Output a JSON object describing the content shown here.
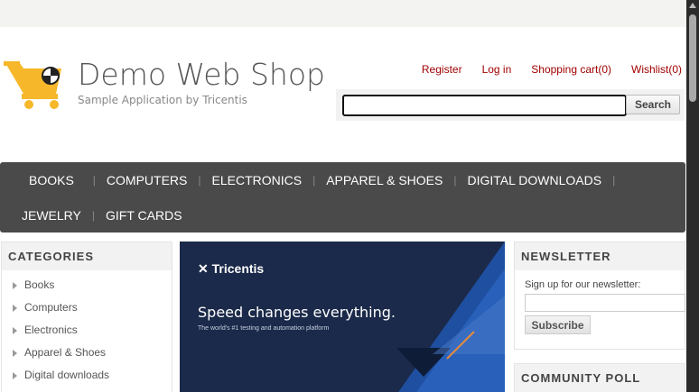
{
  "site": {
    "title": "Demo Web Shop",
    "subtitle": "Sample Application by Tricentis",
    "logo_icon": "shopping-cart-icon"
  },
  "header_links": [
    "Register",
    "Log in",
    "Shopping cart(0)",
    "Wishlist(0)"
  ],
  "search": {
    "value": "",
    "button_label": "Search"
  },
  "topmenu": {
    "row1": [
      "BOOKS",
      "COMPUTERS",
      "ELECTRONICS",
      "APPAREL & SHOES",
      "DIGITAL DOWNLOADS"
    ],
    "row2": [
      "JEWELRY",
      "GIFT CARDS"
    ]
  },
  "categories": {
    "title": "CATEGORIES",
    "items": [
      "Books",
      "Computers",
      "Electronics",
      "Apparel & Shoes",
      "Digital downloads"
    ]
  },
  "banner": {
    "brand": "Tricentis",
    "headline": "Speed changes everything.",
    "subline": "The world's #1 testing and automation platform"
  },
  "newsletter": {
    "title": "NEWSLETTER",
    "label": "Sign up for our newsletter:",
    "button_label": "Subscribe"
  },
  "poll": {
    "title": "COMMUNITY POLL"
  },
  "colors": {
    "link": "#a10000",
    "menu_bg": "#4a4a4a",
    "accent": "#f7b72a"
  }
}
